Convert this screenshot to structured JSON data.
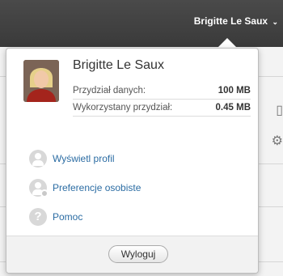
{
  "header": {
    "user_menu_label": "Brigitte Le Saux",
    "caret": "⌄"
  },
  "popup": {
    "user_name": "Brigitte Le Saux",
    "quota": [
      {
        "label": "Przydział danych:",
        "value": "100 MB"
      },
      {
        "label": "Wykorzystany przydział:",
        "value": "0.45 MB"
      }
    ],
    "menu": [
      {
        "label": "Wyświetl profil",
        "icon": "person-icon"
      },
      {
        "label": "Preferencje osobiste",
        "icon": "person-settings-icon"
      },
      {
        "label": "Pomoc",
        "icon": "help-icon"
      }
    ],
    "logout_label": "Wyloguj"
  },
  "colors": {
    "topbar": "#3e3e3e",
    "link": "#2b6ca3",
    "icon_grey": "#d8d8d8"
  }
}
